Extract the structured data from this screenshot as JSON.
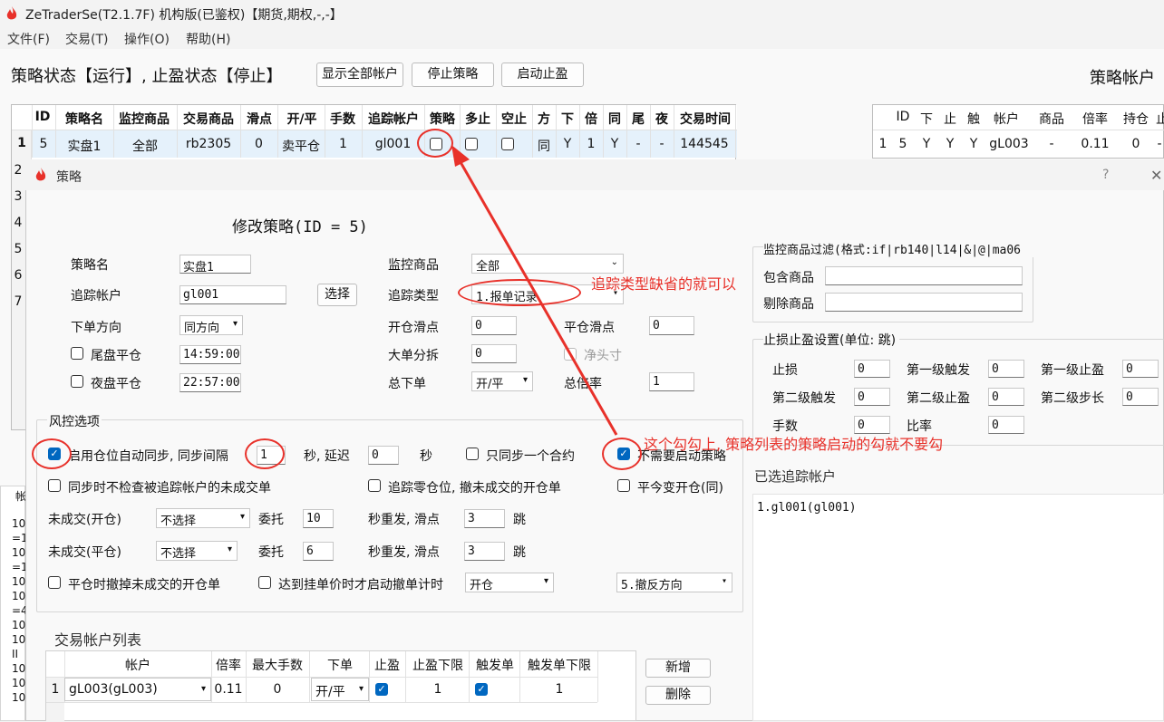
{
  "app": {
    "title": "ZeTraderSe(T2.1.7F) 机构版(已鉴权)【期货,期权,-,-】"
  },
  "menu": [
    "文件(F)",
    "交易(T)",
    "操作(O)",
    "帮助(H)"
  ],
  "status": {
    "text": "策略状态【运行】, 止盈状态【停止】",
    "right_title": "策略帐户"
  },
  "toolbar": {
    "show_all": "显示全部帐户",
    "stop_strategy": "停止策略",
    "start_tp": "启动止盈"
  },
  "strategy_table": {
    "headers": [
      "ID",
      "策略名",
      "监控商品",
      "交易商品",
      "滑点",
      "开/平",
      "手数",
      "追踪帐户",
      "策略",
      "多止",
      "空止",
      "方",
      "下",
      "倍",
      "同",
      "尾",
      "夜",
      "交易时间"
    ],
    "row": {
      "num": "1",
      "id": "5",
      "name": "实盘1",
      "monitor": "全部",
      "trade": "rb2305",
      "slip": "0",
      "oc": "卖平仓",
      "lots": "1",
      "track": "gl001",
      "dir": "同",
      "down": "Y",
      "mult": "1",
      "same": "Y",
      "tail": "-",
      "night": "-",
      "time": "144545"
    },
    "row_nums": [
      "2",
      "3",
      "4",
      "5",
      "6",
      "7"
    ]
  },
  "account_table": {
    "headers": [
      "ID",
      "下",
      "止",
      "触",
      "帐户",
      "商品",
      "倍率",
      "持仓",
      "止盈"
    ],
    "row": {
      "num": "1",
      "id": "5",
      "down": "Y",
      "stop": "Y",
      "trig": "Y",
      "account": "gL003",
      "product": "-",
      "rate": "0.11",
      "pos": "0",
      "tp": "-"
    }
  },
  "dialog": {
    "title": "策略",
    "help": "?",
    "close": "✕",
    "heading": "修改策略(ID = 5)",
    "name_label": "策略名",
    "name_value": "实盘1",
    "track_label": "追踪帐户",
    "track_value": "gl001",
    "select_btn": "选择",
    "dir_label": "下单方向",
    "dir_value": "同方向",
    "tail_label": "尾盘平仓",
    "tail_value": "14:59:00",
    "night_label": "夜盘平仓",
    "night_value": "22:57:00",
    "monitor_label": "监控商品",
    "monitor_value": "全部",
    "tracktype_label": "追踪类型",
    "tracktype_value": "1.报单记录",
    "open_slip_label": "开仓滑点",
    "open_slip_value": "0",
    "close_slip_label": "平仓滑点",
    "close_slip_value": "0",
    "split_label": "大单分拆",
    "split_value": "0",
    "net_label": "净头寸",
    "total_label": "总下单",
    "total_value": "开/平",
    "ratio_label": "总倍率",
    "ratio_value": "1",
    "filter_title": "监控商品过滤(格式:if|rb140|l14|&|@|ma06",
    "include_label": "包含商品",
    "exclude_label": "剔除商品",
    "sltp_title": "止损止盈设置(单位: 跳)",
    "sltp": {
      "stop": "止损",
      "t1": "第一级触发",
      "p1": "第一级止盈",
      "t2": "第二级触发",
      "p2": "第二级止盈",
      "step2": "第二级步长",
      "lots": "手数",
      "rate": "比率",
      "zero": "0"
    },
    "risk_title": "风控选项",
    "risk": {
      "sync_label": "启用仓位自动同步, 同步间隔",
      "sync_interval": "1",
      "delay_label": "秒, 延迟",
      "delay_value": "0",
      "sec": "秒",
      "one_contract": "只同步一个合约",
      "no_start": "不需要启动策略",
      "no_check": "同步时不检查被追踪帐户的未成交单",
      "zero_track": "追踪零仓位, 撤未成交的开仓单",
      "today_open": "平今变开仓(同)",
      "unfilled_open": "未成交(开仓)",
      "unfilled_close": "未成交(平仓)",
      "not_select": "不选择",
      "entrust": "委托",
      "entrust_open": "10",
      "entrust_close": "6",
      "resend": "秒重发, 滑点",
      "resend_slip_open": "3",
      "resend_slip_close": "3",
      "tick": "跳",
      "cancel_on_close": "平仓时撤掉未成交的开仓单",
      "timer_on_price": "达到挂单价时才启动撤单计时",
      "timer_value": "开仓",
      "reverse_value": "5.撤反方向"
    },
    "selected_title": "已选追踪帐户",
    "selected_item": "1.gl001(gl001)",
    "acct_list_title": "交易帐户列表",
    "acct_headers": [
      "帐户",
      "倍率",
      "最大手数",
      "下单",
      "止盈",
      "止盈下限",
      "触发单",
      "触发单下限"
    ],
    "acct_row": {
      "num": "1",
      "account": "gL003(gL003)",
      "rate": "0.11",
      "max": "0",
      "order": "开/平",
      "tp_min": "1",
      "trig_min": "1"
    },
    "add_btn": "新增",
    "del_btn": "删除"
  },
  "annotations": {
    "a1": "追踪类型缺省的就可以",
    "a2": "这个勾勾上, 策略列表的策略启动的勾就不要勾"
  },
  "left_log": [
    "帐",
    "10",
    "=1",
    "10",
    "=1",
    "10",
    "10",
    "=4",
    "10",
    "10",
    "II",
    "10",
    "10",
    "10"
  ],
  "colors": {
    "accent": "#0067c0",
    "annotation": "#e8312a"
  }
}
